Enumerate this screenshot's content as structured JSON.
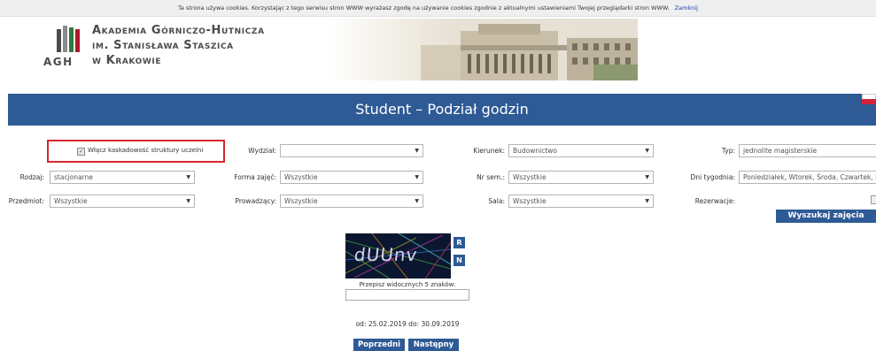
{
  "cookie": {
    "text": "Ta strona używa cookies. Korzystając z tego serwisu stron WWW wyrażasz zgodę na używanie cookies zgodnie z aktualnymi ustawieniami Twojej przeglądarki stron WWW.",
    "close_label": "Zamknij"
  },
  "logo": {
    "line1": "Akademia Górniczo-Hutnicza",
    "line2": "im. Stanisława Staszica",
    "line3": "w Krakowie",
    "abbr": "AGH"
  },
  "header": {
    "title": "Student – Podział godzin"
  },
  "form": {
    "cascade_label": "Włącz kaskadowość struktury uczelni",
    "cascade_checked": true,
    "wydzial": {
      "label": "Wydział:",
      "value": ""
    },
    "kierunek": {
      "label": "Kierunek:",
      "value": "Budownictwo"
    },
    "typ": {
      "label": "Typ:",
      "value": "jednolite magisterskie"
    },
    "rodzaj": {
      "label": "Rodzaj:",
      "value": "stacjonarne"
    },
    "forma": {
      "label": "Forma zajęć:",
      "value": "Wszystkie"
    },
    "nrsem": {
      "label": "Nr sem.:",
      "value": "Wszystkie"
    },
    "dni": {
      "label": "Dni tygodnia:",
      "value": "Poniedziałek, Wtorek, Środa, Czwartek, P"
    },
    "przedmiot": {
      "label": "Przedmiot:",
      "value": "Wszystkie"
    },
    "prowadzacy": {
      "label": "Prowadzący:",
      "value": "Wszystkie"
    },
    "sala": {
      "label": "Sala:",
      "value": "Wszystkie"
    },
    "rezerwacje": {
      "label": "Rezerwacje:"
    },
    "search_label": "Wyszukaj zajęcia"
  },
  "captcha": {
    "text": "dUUnv",
    "refresh_label": "R",
    "new_label": "N",
    "instruction": "Przepisz widocznych 5 znaków:",
    "input_value": ""
  },
  "period": {
    "text": "od: 25.02.2019 do: 30.09.2019"
  },
  "nav": {
    "prev_label": "Poprzedni",
    "next_label": "Następny"
  },
  "colors": {
    "primary": "#2e5a95",
    "highlight": "#d7262d"
  }
}
